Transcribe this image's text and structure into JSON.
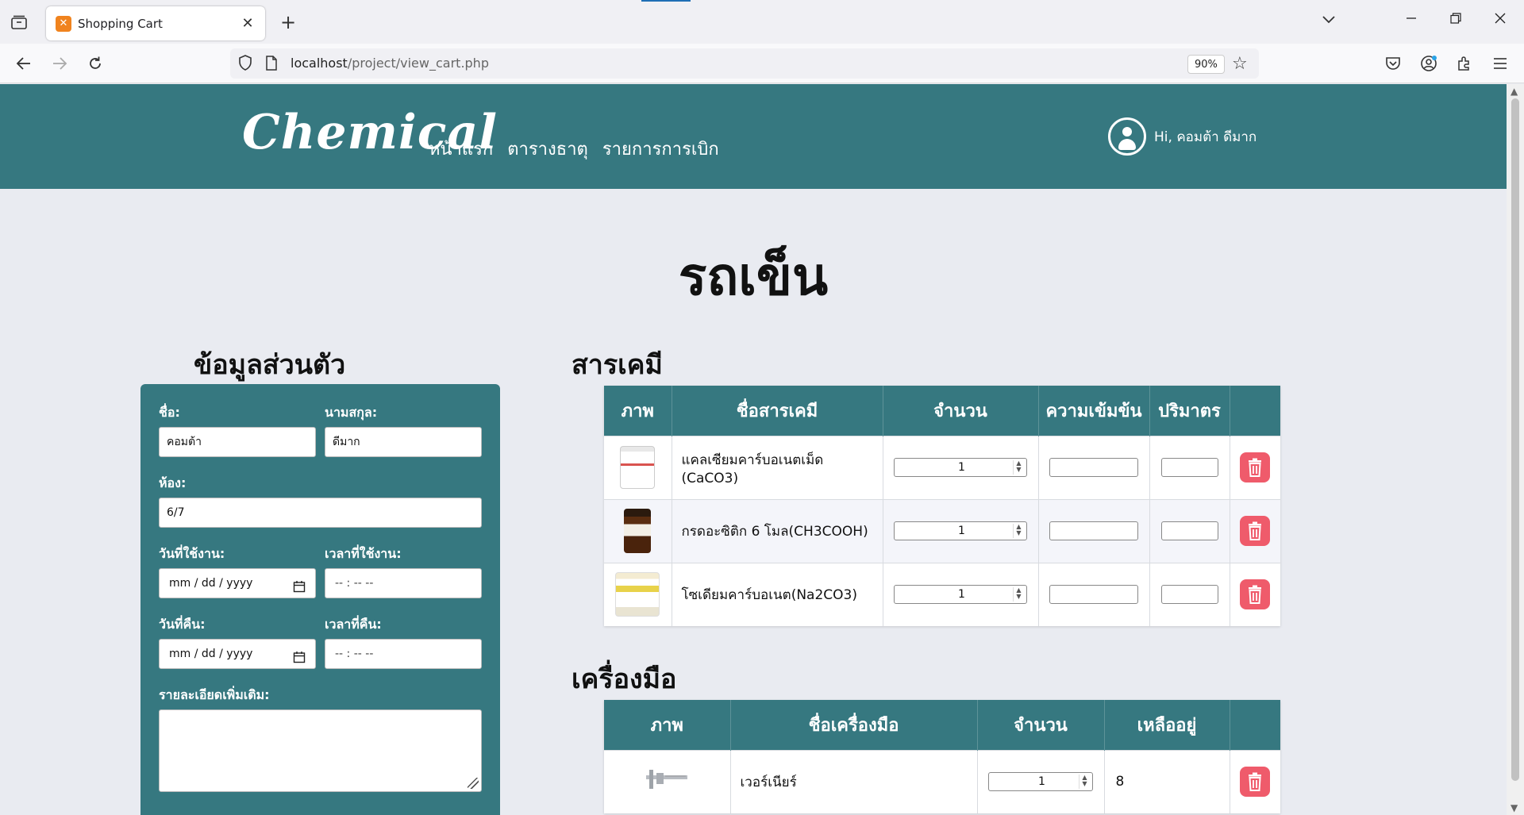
{
  "browser": {
    "tab_title": "Shopping Cart",
    "url_host": "localhost",
    "url_path": "/project/view_cart.php",
    "zoom": "90%"
  },
  "header": {
    "logo": "Chemical",
    "menu": [
      "หน้าแรก",
      "ตารางธาตุ",
      "รายการการเบิก"
    ],
    "greeting": "Hi, คอมต้า ดีมาก"
  },
  "page_title": "รถเข็น",
  "form": {
    "heading": "ข้อมูลส่วนตัว",
    "first_name_label": "ชื่อ:",
    "first_name_value": "คอมต้า",
    "last_name_label": "นามสกุล:",
    "last_name_value": "ดีมาก",
    "room_label": "ห้อง:",
    "room_value": "6/7",
    "use_date_label": "วันที่ใช้งาน:",
    "use_date_placeholder": "mm / dd / yyyy",
    "use_time_label": "เวลาที่ใช้งาน:",
    "use_time_placeholder": "-- : --   --",
    "return_date_label": "วันที่คืน:",
    "return_date_placeholder": "mm / dd / yyyy",
    "return_time_label": "เวลาที่คืน:",
    "return_time_placeholder": "-- : --   --",
    "details_label": "รายละเอียดเพิ่มเติม:"
  },
  "chemicals": {
    "heading": "สารเคมี",
    "columns": [
      "ภาพ",
      "ชื่อสารเคมี",
      "จำนวน",
      "ความเข้มข้น",
      "ปริมาตร"
    ],
    "rows": [
      {
        "name": "แคลเซียมคาร์บอเนตเม็ด (CaCO3)",
        "qty": "1"
      },
      {
        "name": "กรดอะซิติก 6 โมล(CH3COOH)",
        "qty": "1"
      },
      {
        "name": "โซเดียมคาร์บอเนต(Na2CO3)",
        "qty": "1"
      }
    ]
  },
  "tools": {
    "heading": "เครื่องมือ",
    "columns": [
      "ภาพ",
      "ชื่อเครื่องมือ",
      "จำนวน",
      "เหลืออยู่"
    ],
    "rows": [
      {
        "name": "เวอร์เนียร์",
        "qty": "1",
        "remaining": "8"
      }
    ]
  },
  "colors": {
    "brand_teal": "#367880",
    "delete_red": "#ef5b6b",
    "page_bg": "#e9ebf1"
  }
}
